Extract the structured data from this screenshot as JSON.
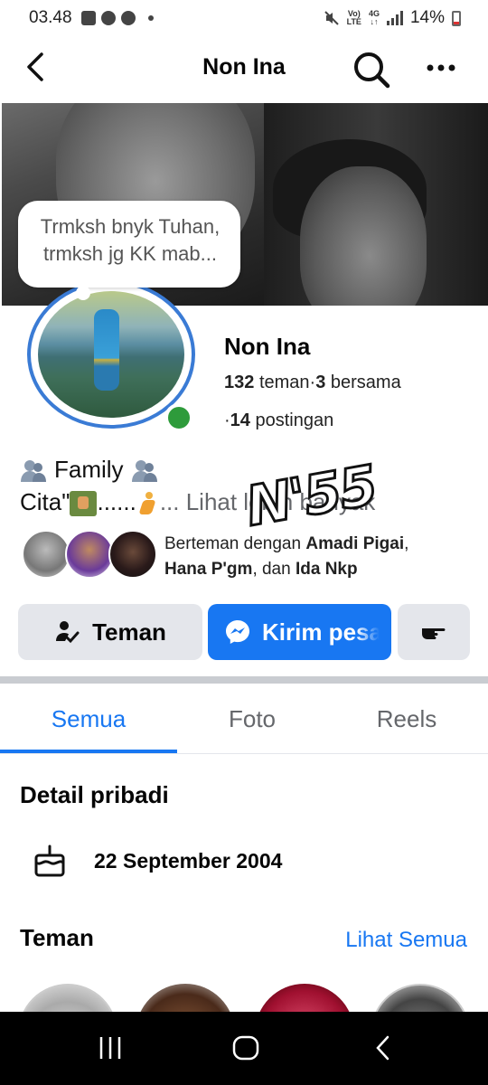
{
  "status_bar": {
    "time": "03.48",
    "network_top": "Vo)",
    "network_bottom": "LTE",
    "gen_top": "4G",
    "gen_bottom": "↓↑",
    "battery": "14%"
  },
  "header": {
    "title": "Non Ina"
  },
  "cover": {
    "note_text": "Trmksh bnyk Tuhan, trmksh jg KK mab..."
  },
  "profile": {
    "name": "Non Ina",
    "friends_count": "132",
    "friends_label": "teman",
    "mutual_count": "3",
    "mutual_label": "bersama",
    "posts_count": "14",
    "posts_label": "postingan",
    "online_color": "#2e9b3b"
  },
  "bio": {
    "line1": "Family",
    "line2_prefix": "Cita\"",
    "line2_dots": "......",
    "see_more": "... Lihat lebih banyak",
    "watermark": "N'55"
  },
  "mutual_friends": {
    "prefix": "Berteman dengan ",
    "name1": "Amadi Pigai",
    "sep1": ",",
    "name2": "Hana P'gm",
    "conj": ", dan ",
    "name3": "Ida Nkp"
  },
  "actions": {
    "friend_label": "Teman",
    "message_label": "Kirim pesan",
    "more_icon": "hand-point-icon"
  },
  "tabs": [
    {
      "label": "Semua",
      "active": true
    },
    {
      "label": "Foto",
      "active": false
    },
    {
      "label": "Reels",
      "active": false
    }
  ],
  "details": {
    "title": "Detail pribadi",
    "birthday": "22 September 2004"
  },
  "friends_section": {
    "title": "Teman",
    "see_all": "Lihat Semua"
  },
  "colors": {
    "accent": "#1877f2",
    "button_gray": "#e4e6eb",
    "secondary_text": "#65676b"
  }
}
